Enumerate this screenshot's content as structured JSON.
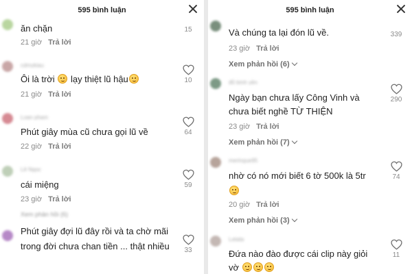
{
  "header": {
    "title": "595 bình luận",
    "close_icon": "close-icon"
  },
  "common": {
    "reply_label": "Trả lời",
    "heart_icon": "heart-outline-icon",
    "emoji_icon": "emoji-icon"
  },
  "left": {
    "comments": [
      {
        "text": "ăn chặn",
        "time": "21 giờ",
        "likes": "15"
      },
      {
        "username": "cdmykiau",
        "text": "Ôi là trời",
        "text_b": "lạy thiệt lũ hậu",
        "time": "21 giờ",
        "likes": "10"
      },
      {
        "username": "Loan pham",
        "text": "Phút giây mùa cũ chưa gọi lũ về",
        "time": "22 giờ",
        "likes": "64"
      },
      {
        "username": "Lê Ngọc",
        "text": "cái miệng",
        "time": "23 giờ",
        "likes": "59"
      },
      {
        "username": "Nguyễn đức",
        "text": "Phút giây đợi lũ đây rồi và ta chờ mãi",
        "text_line2": "trong đời chưa chan tiền ... thật nhiều",
        "likes": "33"
      }
    ],
    "hidden_line": "Xem phản hồi (6)"
  },
  "right": {
    "comments": [
      {
        "text": "Và chúng ta lại đón lũ về.",
        "time": "23 giờ",
        "likes": "339",
        "view_replies": "Xem phản hồi (6)"
      },
      {
        "username": "đỗ bình yên",
        "text": "Ngày bạn chưa lấy Công Vinh và",
        "text_line2": "chưa biết nghề TỪ THIỆN",
        "time": "23 giờ",
        "likes": "290",
        "view_replies": "Xem phản hồi (7)"
      },
      {
        "username": "meringue95",
        "text": "nhờ có nó mới biết 6 tờ 500k là 5tr",
        "time": "20 giờ",
        "likes": "74",
        "view_replies": "Xem phản hồi (3)"
      },
      {
        "username": "Letata",
        "text": "Đứa nào đào được cái clip này giỏi",
        "text_line2": "vờ",
        "likes": "11"
      }
    ]
  },
  "colors": {
    "avatar1": "#b9d6a0",
    "avatar2": "#c9a7a7",
    "avatar3": "#d68a93",
    "avatar4": "#bfcfb8",
    "avatar5": "#b689c7",
    "avatar6": "#7a8f7d",
    "avatar7": "#7d9a86",
    "avatar8": "#b7a49b",
    "avatar9": "#c4b8b4"
  }
}
